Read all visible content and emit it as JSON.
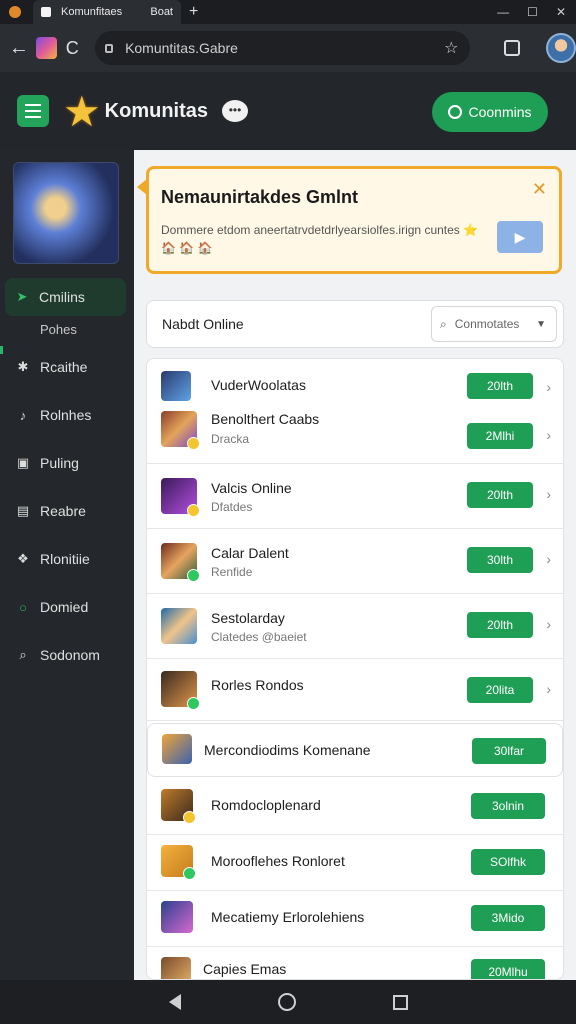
{
  "browser": {
    "tab_title": "Komunfitaes",
    "tab_extra": "Boat",
    "new_tab": "+",
    "url": "Komuntitas.Gabre",
    "back": "←",
    "reload": "C",
    "star": "☆"
  },
  "window_controls": {
    "minimize": "—",
    "maximize": "☐",
    "close": "✕"
  },
  "header": {
    "brand": "Komunitas",
    "connect_label": "Coonmins",
    "accent_color": "#1f9e55"
  },
  "sidebar": {
    "items": [
      {
        "label": "Cmilins",
        "icon": "arrow-icon",
        "active": true
      },
      {
        "label": "Rcaithe",
        "icon": "puzzle-icon",
        "active": false
      },
      {
        "label": "Rolnhes",
        "icon": "music-icon",
        "active": false
      },
      {
        "label": "Puling",
        "icon": "image-icon",
        "active": false
      },
      {
        "label": "Reabre",
        "icon": "bag-icon",
        "active": false
      },
      {
        "label": "Rlonitiie",
        "icon": "gift-icon",
        "active": false
      },
      {
        "label": "Domied",
        "icon": "circle-icon",
        "active": false
      },
      {
        "label": "Sodonom",
        "icon": "search-icon",
        "active": false
      }
    ],
    "subitem": "Pohes"
  },
  "banner": {
    "title": "Nemaunirtakdes Gmlnt",
    "description": "Dommere etdom aneertatrvdetdrlyearsiolfes.irign cuntes",
    "emoji": "⭐ 🏠 🏠 🏠",
    "close": "✕",
    "play": "▶"
  },
  "filter": {
    "label": "Nabdt Online",
    "select_placeholder": "Conmotates",
    "chevron": "▼"
  },
  "list": [
    {
      "name": "VuderWoolatas",
      "sub": "",
      "time": "20lth"
    },
    {
      "name": "Benolthert Caabs",
      "sub": "Dracka",
      "time": "2Mlhi"
    },
    {
      "name": "Valcis Online",
      "sub": "Dfatdes",
      "time": "20lth"
    },
    {
      "name": "Calar Dalent",
      "sub": "Renfide",
      "time": "30lth"
    },
    {
      "name": "Sestolarday",
      "sub": "Clatedes @baeiet",
      "time": "20lth"
    },
    {
      "name": "Rorles Rondos",
      "sub": "",
      "time": "20lita"
    },
    {
      "name": "Mercondiodims Komenane",
      "sub": "",
      "time": "30lfar"
    },
    {
      "name": "Romdocloplenard",
      "sub": "",
      "time": "3olnin"
    },
    {
      "name": "Morooflehes Ronloret",
      "sub": "",
      "time": "SOlfhk"
    },
    {
      "name": "Mecatiemy Erlorolehiens",
      "sub": "",
      "time": "3Mido"
    },
    {
      "name": "Capies Emas",
      "sub": "",
      "time": "20Mlhu"
    }
  ]
}
